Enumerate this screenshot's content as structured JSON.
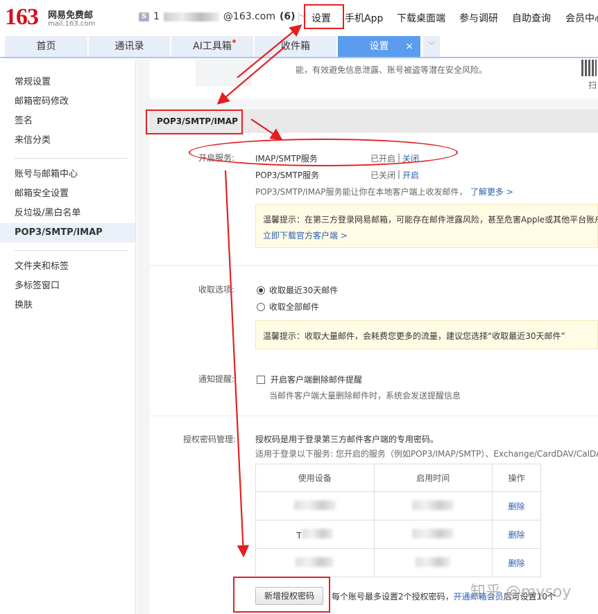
{
  "header": {
    "logo_number": "163",
    "logo_name": "网易免费邮",
    "logo_domain": "mail.163.com",
    "account_prefix": "1",
    "account_suffix": "@163.com",
    "unread_count": "(6)",
    "nav": [
      "设置",
      "手机App",
      "下载桌面端",
      "参与调研",
      "自助查询",
      "会员中心"
    ]
  },
  "tabs": [
    {
      "label": "首页"
    },
    {
      "label": "通讯录"
    },
    {
      "label": "AI工具箱"
    },
    {
      "label": "收件箱"
    },
    {
      "label": "设置",
      "close": "×"
    }
  ],
  "sidebar": {
    "group1": [
      "常规设置",
      "邮箱密码修改",
      "签名",
      "来信分类"
    ],
    "group2": [
      "账号与邮箱中心",
      "邮箱安全设置",
      "反垃圾/黑白名单",
      "POP3/SMTP/IMAP"
    ],
    "group3": [
      "文件夹和标签",
      "多标签窗口",
      "换肤"
    ]
  },
  "top_notice": "能，有效避免信息泄露、账号被盗等潜在安全风险。",
  "qr_caption": "扫",
  "section_title": "POP3/SMTP/IMAP",
  "services": {
    "label": "开启服务:",
    "rows": [
      {
        "name": "IMAP/SMTP服务",
        "status": "已开启",
        "sep": "|",
        "action": "关闭"
      },
      {
        "name": "POP3/SMTP服务",
        "status": "已关闭",
        "sep": "|",
        "action": "开启"
      }
    ],
    "desc": "POP3/SMTP/IMAP服务能让你在本地客户端上收发邮件，",
    "learn_more": "了解更多 >",
    "tip_text": "温馨提示：在第三方登录网易邮箱，可能存在邮件泄露风险，甚至危害Apple或其他平台账户",
    "tip_link": "立即下载官方客户端 >"
  },
  "receive": {
    "label": "收取选项:",
    "options": [
      "收取最近30天邮件",
      "收取全部邮件"
    ],
    "selected": "收取最近30天邮件",
    "tip": "温馨提示：收取大量邮件，会耗费您更多的流量，建议您选择“收取最近30天邮件”"
  },
  "notify": {
    "label": "通知提醒:",
    "checkbox_label": "开启客户端删除邮件提醒",
    "desc": "当邮件客户端大量删除邮件时，系统会发送提醒信息"
  },
  "auth": {
    "label": "授权密码管理:",
    "desc1": "授权码是用于登录第三方邮件客户端的专用密码。",
    "desc2": "适用于登录以下服务: 您开启的服务（例如POP3/IMAP/SMTP）、Exchange/CardDAV/CalDAV",
    "columns": [
      "使用设备",
      "启用时间",
      "操作"
    ],
    "rows": [
      {
        "action": "删除"
      },
      {
        "device_prefix": "T",
        "action": "删除"
      },
      {
        "action": "删除"
      }
    ],
    "add_button": "新增授权密码",
    "limit_text": "每个账号最多设置2个授权密码，",
    "vip_link": "开通邮箱会员",
    "limit_suffix": "后可设置10个"
  },
  "watermark": "知乎 @mysoy",
  "colors": {
    "brand_red": "#d3121a",
    "tab_active": "#5c9cef",
    "annotation_red": "#e32020",
    "link": "#2a5fb0"
  }
}
